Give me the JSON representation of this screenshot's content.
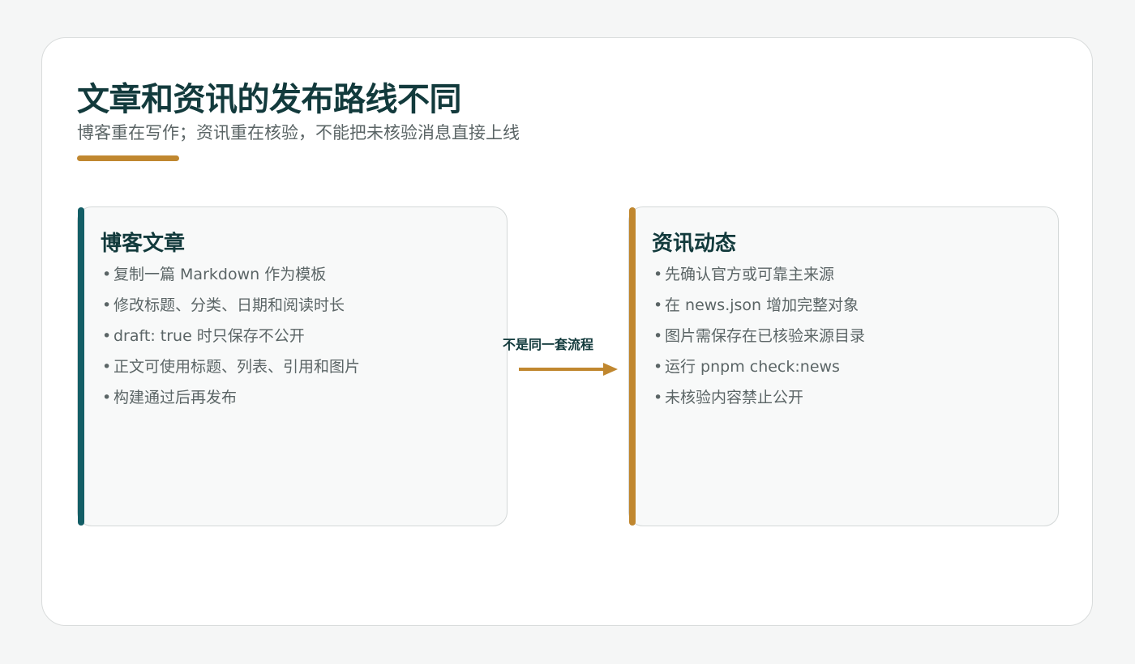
{
  "title": "文章和资讯的发布路线不同",
  "subtitle": "博客重在写作；资讯重在核验，不能把未核验消息直接上线",
  "colors": {
    "accent": "#c0872f",
    "teal": "#135e66",
    "title_text": "#123a3c",
    "body_text": "#5b6566"
  },
  "blog": {
    "title": "博客文章",
    "items": [
      "复制一篇 Markdown 作为模板",
      "修改标题、分类、日期和阅读时长",
      "draft: true 时只保存不公开",
      "正文可使用标题、列表、引用和图片",
      "构建通过后再发布"
    ]
  },
  "connector": {
    "label": "不是同一套流程",
    "icon": "arrow-right-icon"
  },
  "news": {
    "title": "资讯动态",
    "items": [
      "先确认官方或可靠主来源",
      "在 news.json 增加完整对象",
      "图片需保存在已核验来源目录",
      "运行 pnpm check:news",
      "未核验内容禁止公开"
    ]
  },
  "bullet": "•"
}
